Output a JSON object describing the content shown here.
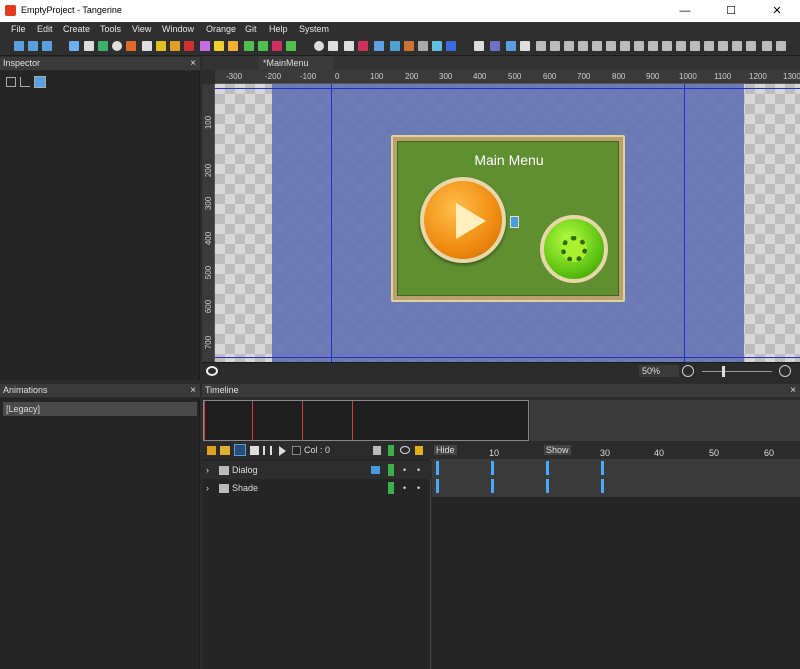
{
  "window": {
    "title": "EmptyProject - Tangerine",
    "minimize": "—",
    "maximize": "☐",
    "close": "✕"
  },
  "menu": [
    "File",
    "Edit",
    "Create",
    "Tools",
    "View",
    "Window",
    "Orange",
    "Git",
    "Help",
    "System"
  ],
  "panels": {
    "inspector": "Inspector",
    "animations": "Animations",
    "timeline": "Timeline",
    "close_glyph": "×"
  },
  "document": {
    "tab": "*MainMenu",
    "zoom": "50%"
  },
  "ruler_h": [
    "-300",
    "-200",
    "-100",
    "0",
    "100",
    "200",
    "300",
    "400",
    "500",
    "600",
    "700",
    "800",
    "900",
    "1000",
    "1100",
    "1200",
    "1300"
  ],
  "ruler_v": [
    "100",
    "200",
    "300",
    "400",
    "500",
    "600",
    "700"
  ],
  "dialog": {
    "title": "Main Menu"
  },
  "animations": {
    "selected": "[Legacy]"
  },
  "timeline": {
    "col_label": "Col : 0",
    "markers": [
      {
        "label": "Hide"
      },
      {
        "label": "Show"
      }
    ],
    "frame_labels": [
      "10",
      "30",
      "40",
      "50",
      "60"
    ],
    "rows": [
      {
        "name": "Dialog"
      },
      {
        "name": "Shade"
      }
    ]
  }
}
